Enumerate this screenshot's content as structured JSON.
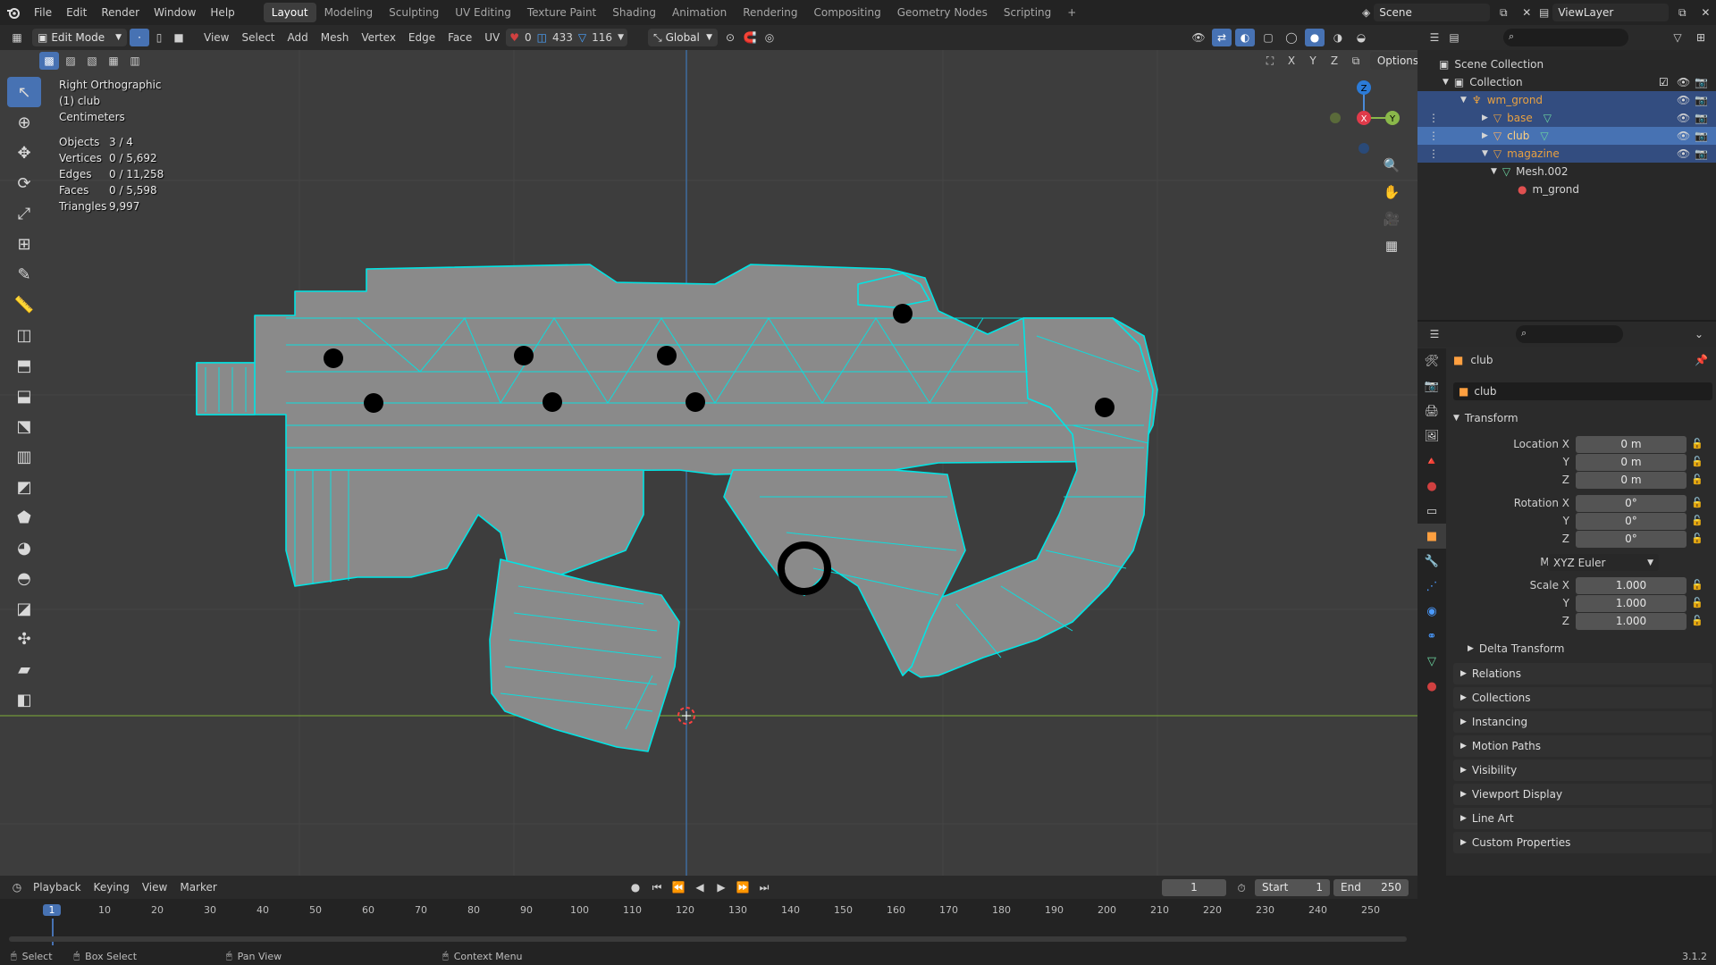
{
  "app": {
    "menu": [
      "File",
      "Edit",
      "Render",
      "Window",
      "Help"
    ],
    "workspaces": [
      "Layout",
      "Modeling",
      "Sculpting",
      "UV Editing",
      "Texture Paint",
      "Shading",
      "Animation",
      "Rendering",
      "Compositing",
      "Geometry Nodes",
      "Scripting"
    ],
    "active_workspace": "Layout",
    "add_workspace": "+",
    "scene_name": "Scene",
    "view_layer": "ViewLayer"
  },
  "viewport_header": {
    "mode": "Edit Mode",
    "menus": [
      "View",
      "Select",
      "Add",
      "Mesh",
      "Vertex",
      "Edge",
      "Face",
      "UV"
    ],
    "stat_verts": "0",
    "stat_edges": "433",
    "stat_faces": "116",
    "orientation": "Global",
    "options_label": "Options",
    "axes": [
      "X",
      "Y",
      "Z"
    ]
  },
  "overlay": {
    "view_name": "Right Orthographic",
    "object_label": "(1) club",
    "units": "Centimeters",
    "stats": [
      {
        "key": "Objects",
        "value": "3 / 4"
      },
      {
        "key": "Vertices",
        "value": "0 / 5,692"
      },
      {
        "key": "Edges",
        "value": "0 / 11,258"
      },
      {
        "key": "Faces",
        "value": "0 / 5,598"
      },
      {
        "key": "Triangles",
        "value": "9,997"
      }
    ]
  },
  "gizmo": {
    "x": "X",
    "y": "Y",
    "z": "Z"
  },
  "outliner": {
    "search_placeholder": "",
    "rows": [
      {
        "label": "Scene Collection",
        "type": "scene"
      },
      {
        "label": "Collection",
        "type": "collection"
      },
      {
        "label": "wm_grond",
        "type": "armature"
      },
      {
        "label": "base",
        "type": "mesh"
      },
      {
        "label": "club",
        "type": "mesh"
      },
      {
        "label": "magazine",
        "type": "mesh"
      },
      {
        "label": "Mesh.002",
        "type": "meshdata"
      },
      {
        "label": "m_grond",
        "type": "material"
      }
    ]
  },
  "properties": {
    "object_name": "club",
    "datablock_name": "club",
    "transform_label": "Transform",
    "location_label": "Location X",
    "rotation_label": "Rotation X",
    "scale_label": "Scale X",
    "axis_y": "Y",
    "axis_z": "Z",
    "location": [
      "0 m",
      "0 m",
      "0 m"
    ],
    "rotation": [
      "0°",
      "0°",
      "0°"
    ],
    "mode_label": "Mode",
    "mode_value": "XYZ Euler",
    "scale": [
      "1.000",
      "1.000",
      "1.000"
    ],
    "delta_transform": "Delta Transform",
    "panels": [
      "Relations",
      "Collections",
      "Instancing",
      "Motion Paths",
      "Visibility",
      "Viewport Display",
      "Line Art",
      "Custom Properties"
    ]
  },
  "timeline": {
    "menus": [
      "Playback",
      "Keying",
      "View",
      "Marker"
    ],
    "current_frame": "1",
    "start_label": "Start",
    "start": "1",
    "end_label": "End",
    "end": "250",
    "ticks": [
      "1",
      "10",
      "20",
      "30",
      "40",
      "50",
      "60",
      "70",
      "80",
      "90",
      "100",
      "110",
      "120",
      "130",
      "140",
      "150",
      "160",
      "170",
      "180",
      "190",
      "200",
      "210",
      "220",
      "230",
      "240",
      "250"
    ]
  },
  "statusbar": {
    "select": "Select",
    "box_select": "Box Select",
    "pan_view": "Pan View",
    "context_menu": "Context Menu",
    "version": "3.1.2"
  },
  "colors": {
    "wire": "#00e5e5",
    "mesh_fill": "#8a8a8a",
    "selection": "#334d80",
    "accent": "#4772b3"
  }
}
